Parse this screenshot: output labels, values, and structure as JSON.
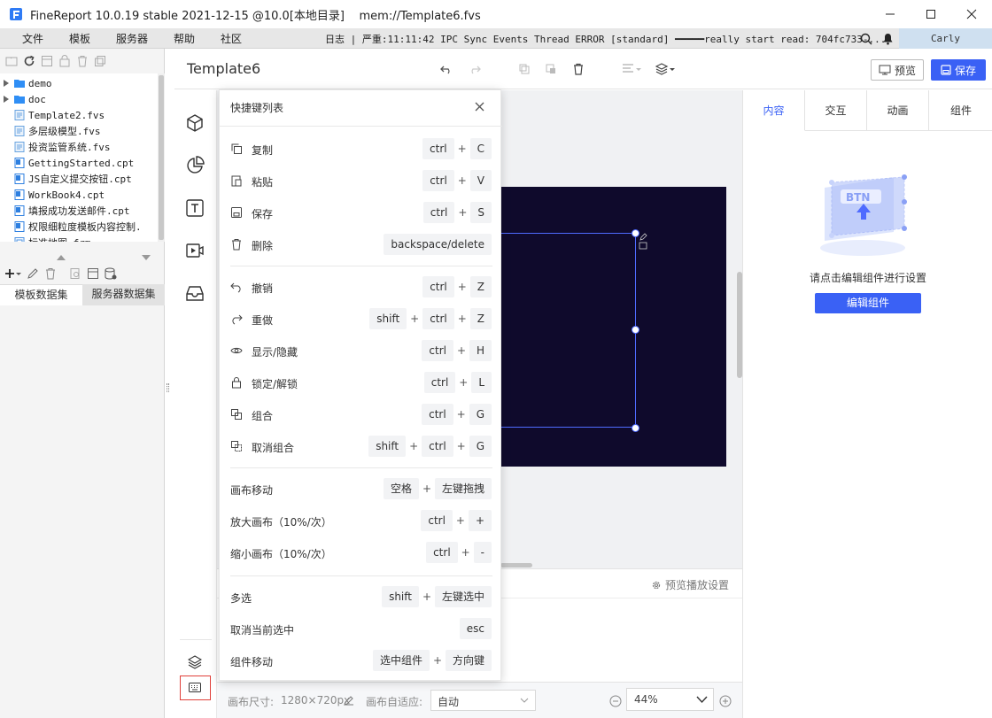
{
  "window": {
    "title": "FineReport 10.0.19 stable 2021-12-15 @10.0[本地目录]    mem://Template6.fvs"
  },
  "menubar": {
    "items": [
      "文件",
      "模板",
      "服务器",
      "帮助",
      "社区"
    ],
    "log_text": "日志 | 严重:11:11:42 IPC Sync Events Thread ERROR [standard] ━━━━━really start read: 704fc733-...",
    "user": "Carly"
  },
  "file_tree": [
    {
      "name": "demo",
      "type": "folder"
    },
    {
      "name": "doc",
      "type": "folder"
    },
    {
      "name": "Template2.fvs",
      "type": "fvs"
    },
    {
      "name": "多层级模型.fvs",
      "type": "fvs"
    },
    {
      "name": "投资监管系统.fvs",
      "type": "fvs"
    },
    {
      "name": "GettingStarted.cpt",
      "type": "cpt"
    },
    {
      "name": "JS自定义提交按钮.cpt",
      "type": "cpt"
    },
    {
      "name": "WorkBook4.cpt",
      "type": "cpt"
    },
    {
      "name": "填报成功发送邮件.cpt",
      "type": "cpt"
    },
    {
      "name": "权限细粒度模板内容控制.",
      "type": "cpt"
    },
    {
      "name": "标准地图.frm",
      "type": "frm"
    }
  ],
  "dataset_tabs": [
    "模板数据集",
    "服务器数据集"
  ],
  "header": {
    "doc_title": "Template6",
    "preview_label": "预览",
    "save_label": "保存"
  },
  "right_panel": {
    "tabs": [
      "内容",
      "交互",
      "动画",
      "组件"
    ],
    "hint": "请点击编辑组件进行设置",
    "edit_button": "编辑组件",
    "illustration_text": "BTN"
  },
  "bottom": {
    "playback_settings": "预览播放设置"
  },
  "status": {
    "canvas_size_label": "画布尺寸:",
    "canvas_size": "1280×720px",
    "canvas_fit_label": "画布自适应:",
    "canvas_fit_value": "自动",
    "zoom": "44%"
  },
  "shortcuts": {
    "title": "快捷键列表",
    "groups": [
      [
        {
          "label": "复制",
          "icon": "copy-icon",
          "keys": [
            "ctrl",
            "C"
          ]
        },
        {
          "label": "粘贴",
          "icon": "paste-icon",
          "keys": [
            "ctrl",
            "V"
          ]
        },
        {
          "label": "保存",
          "icon": "save-icon",
          "keys": [
            "ctrl",
            "S"
          ]
        },
        {
          "label": "删除",
          "icon": "trash-icon",
          "keys": [
            "backspace/delete"
          ]
        }
      ],
      [
        {
          "label": "撤销",
          "icon": "undo-icon",
          "keys": [
            "ctrl",
            "Z"
          ]
        },
        {
          "label": "重做",
          "icon": "redo-icon",
          "keys": [
            "shift",
            "ctrl",
            "Z"
          ]
        },
        {
          "label": "显示/隐藏",
          "icon": "eye-icon",
          "keys": [
            "ctrl",
            "H"
          ]
        },
        {
          "label": "锁定/解锁",
          "icon": "lock-icon",
          "keys": [
            "ctrl",
            "L"
          ]
        },
        {
          "label": "组合",
          "icon": "group-icon",
          "keys": [
            "ctrl",
            "G"
          ]
        },
        {
          "label": "取消组合",
          "icon": "ungroup-icon",
          "keys": [
            "shift",
            "ctrl",
            "G"
          ]
        }
      ],
      [
        {
          "label": "画布移动",
          "icon": "",
          "keys": [
            "空格",
            "左键拖拽"
          ]
        },
        {
          "label": "放大画布（10%/次）",
          "icon": "",
          "keys": [
            "ctrl",
            "+"
          ]
        },
        {
          "label": "缩小画布（10%/次）",
          "icon": "",
          "keys": [
            "ctrl",
            "-"
          ]
        }
      ],
      [
        {
          "label": "多选",
          "icon": "",
          "keys": [
            "shift",
            "左键选中"
          ]
        },
        {
          "label": "取消当前选中",
          "icon": "",
          "keys": [
            "esc"
          ]
        },
        {
          "label": "组件移动",
          "icon": "",
          "keys": [
            "选中组件",
            "方向键"
          ]
        }
      ]
    ]
  },
  "colors": {
    "accent": "#3a61f5",
    "canvas_bg": "#0f0a2c",
    "selection": "#4f6bff"
  }
}
